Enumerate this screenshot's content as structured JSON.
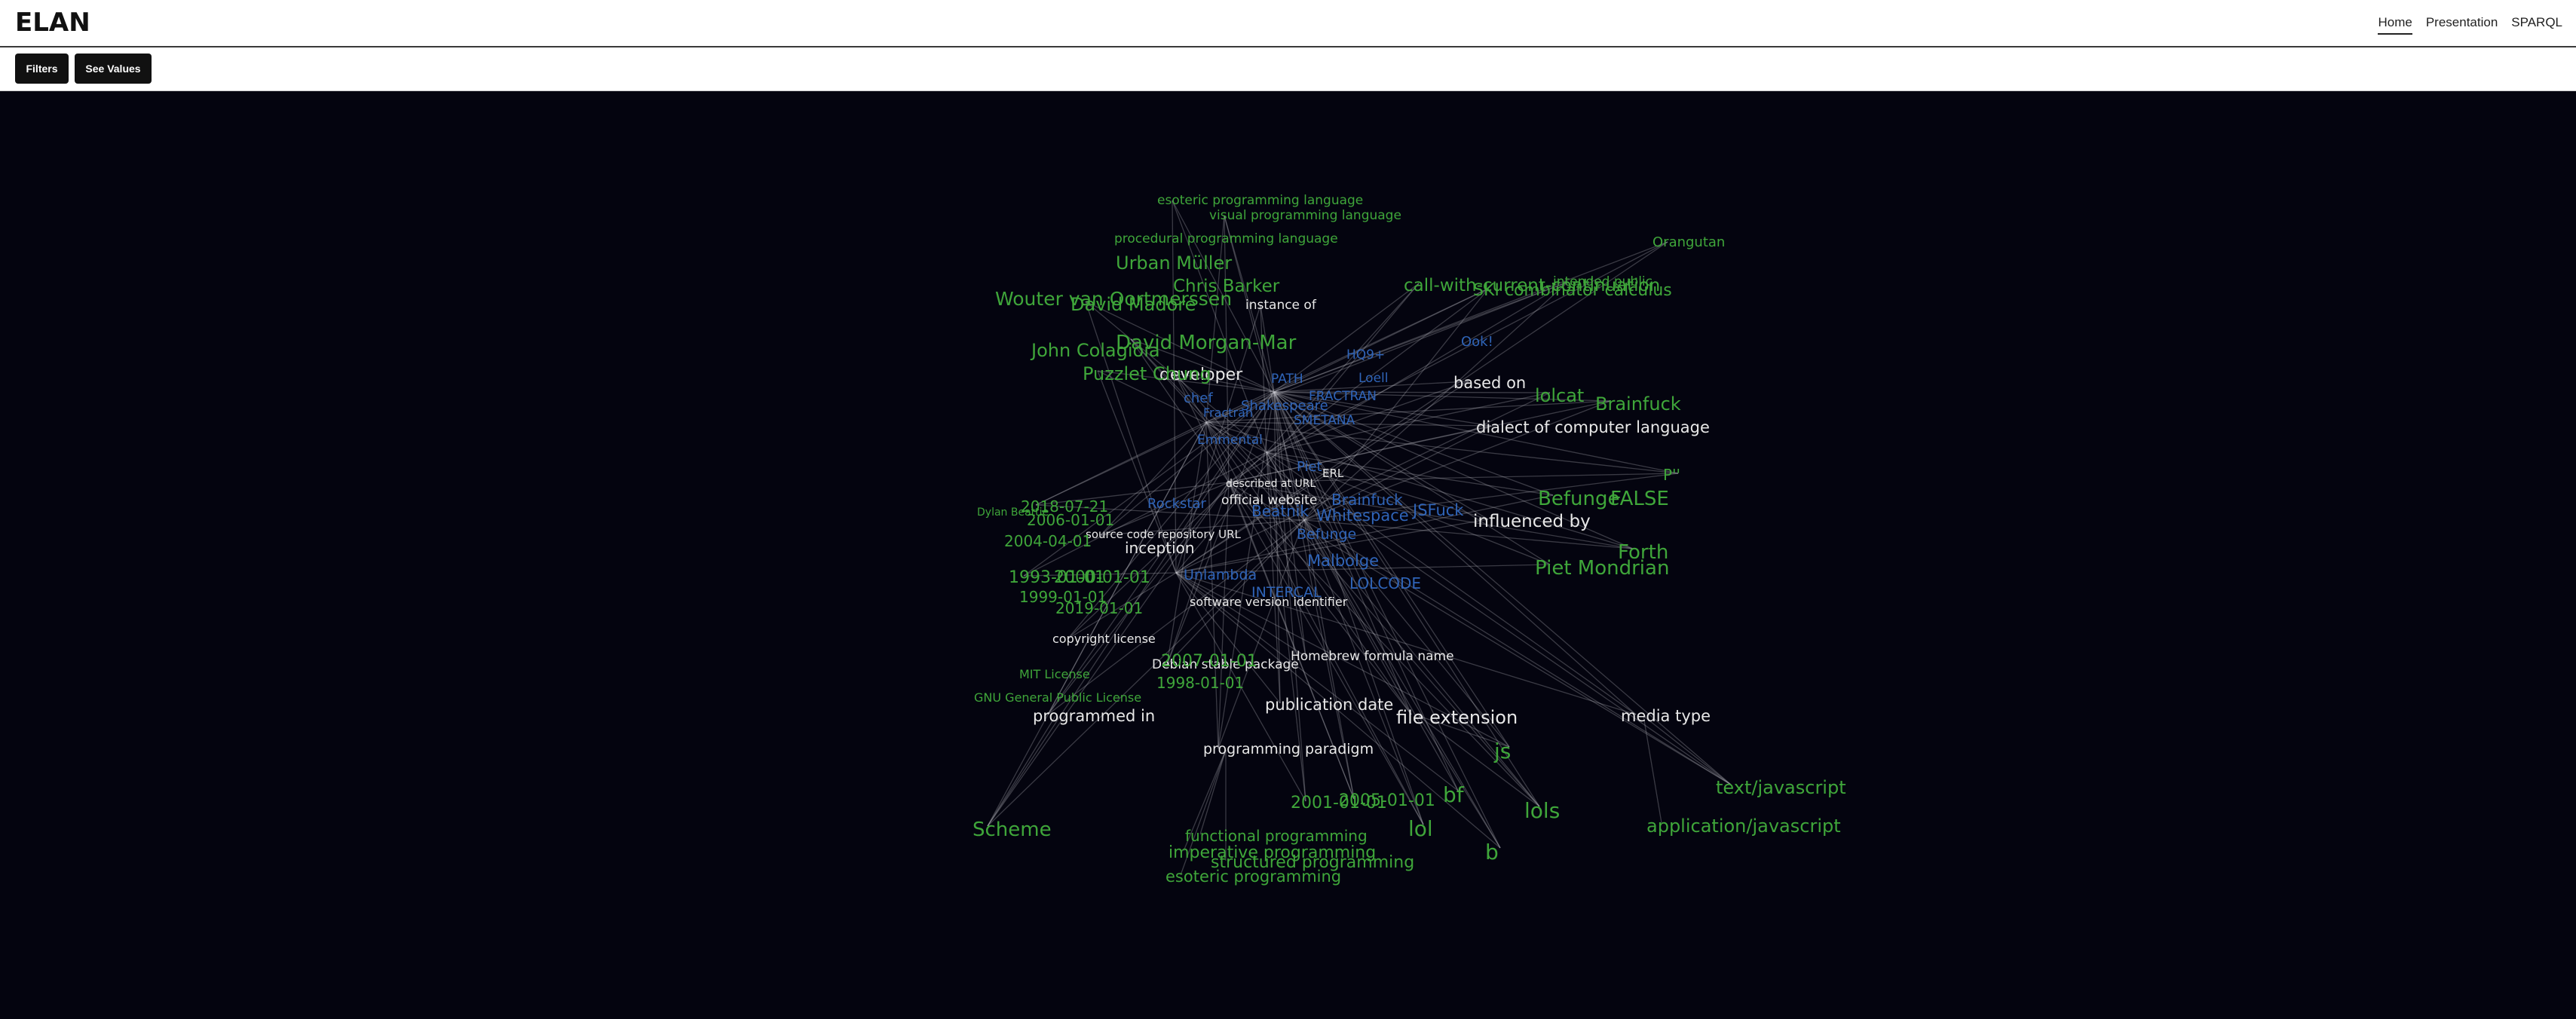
{
  "app": {
    "title": "ELAN"
  },
  "nav": {
    "items": [
      "Home",
      "Presentation",
      "SPARQL"
    ],
    "active": "Home"
  },
  "toolbar": {
    "filters_label": "Filters",
    "values_label": "See Values"
  },
  "colors": {
    "background": "#04040f",
    "value": "#3fa63a",
    "item": "#2f64b8",
    "property": "#e8e8e8",
    "edge": "#c8c8d0"
  },
  "graph": {
    "properties": [
      "instance of",
      "developer",
      "based on",
      "dialect of computer language",
      "described at URL",
      "official website",
      "source code repository URL",
      "inception",
      "influenced by",
      "software version identifier",
      "copyright license",
      "Debian stable package",
      "Homebrew formula name",
      "publication date",
      "programmed in",
      "file extension",
      "media type",
      "programming paradigm",
      "ERL"
    ],
    "values": [
      "esoteric programming language",
      "visual programming language",
      "procedural programming language",
      "Urban Müller",
      "Chris Barker",
      "David Madore",
      "Wouter van Oortmerssen",
      "John Colagioia",
      "Puzzlet Chung",
      "David Morgan-Mar",
      "call-with-current-continuation",
      "SKI combinator calculus",
      "intended public",
      "Orangutan",
      "lolcat",
      "Brainfuck",
      "P''",
      "Befunge",
      "FALSE",
      "Forth",
      "Piet Mondrian",
      "2018-07-21",
      "2006-01-01",
      "2004-04-01",
      "1993-01-01",
      "2000-01-01",
      "1999-01-01",
      "2019-01-01",
      "2007-01-01",
      "1998-01-01",
      "2001-01-01",
      "2005-01-01",
      "MIT License",
      "GNU General Public License",
      "Dylan Beattie",
      "Scheme",
      "js",
      "lols",
      "bf",
      "lol",
      "b",
      "text/javascript",
      "application/javascript",
      "functional programming",
      "imperative programming",
      "structured programming",
      "esoteric programming"
    ],
    "items": [
      "HQ9+",
      "Ook!",
      "PATH",
      "Emmental",
      "chef",
      "Piet",
      "Rockstar",
      "Beatnik",
      "Whitespace",
      "JSFuck",
      "Brainfuck",
      "Malbolge",
      "INTERCAL",
      "LOLCODE",
      "Unlambda",
      "FRACTRAN",
      "Shakespeare",
      "SMETANA",
      "Loell",
      "Befunge",
      "Fractran"
    ]
  }
}
